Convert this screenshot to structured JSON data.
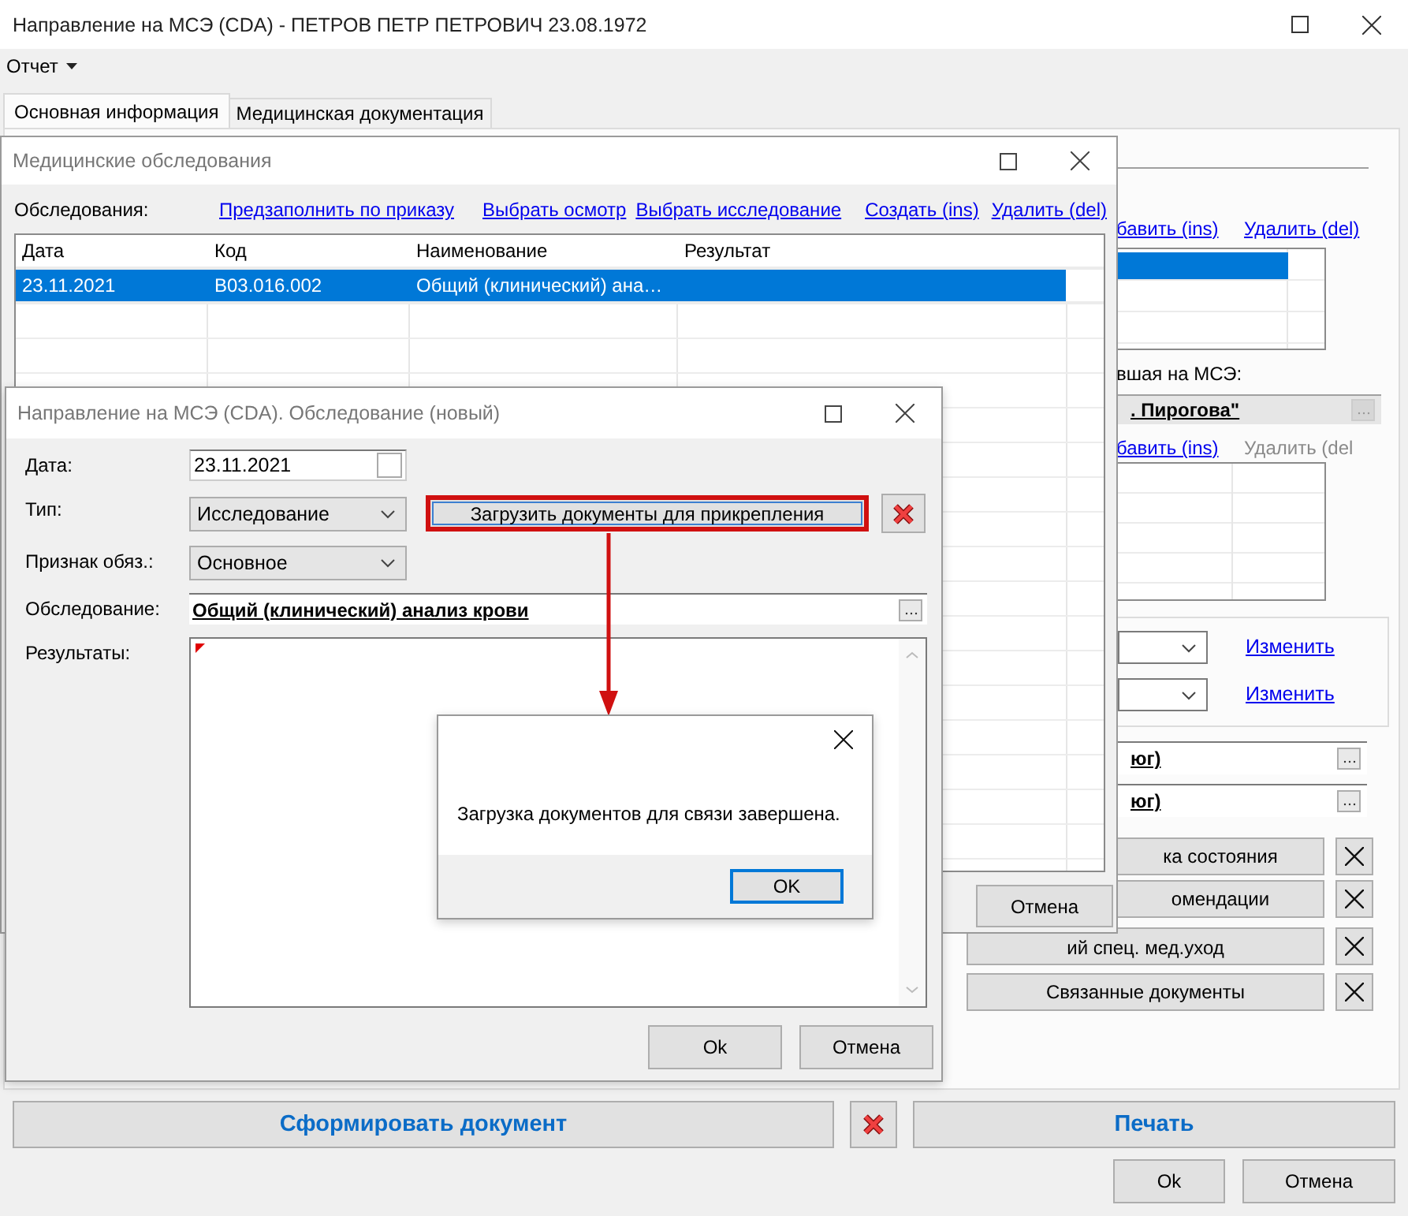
{
  "main_window": {
    "title": "Направление на МСЭ (CDA) - ПЕТРОВ ПЕТР ПЕТРОВИЧ 23.08.1972",
    "menu": [
      {
        "label": "Отчет"
      }
    ],
    "tabs": [
      {
        "label": "Основная информация",
        "selected": true
      },
      {
        "label": "Медицинская документация",
        "selected": false
      }
    ],
    "panel": {
      "links_1": [
        {
          "label": "бавить (ins)",
          "disabled": false
        },
        {
          "label": "Удалить (del)",
          "disabled": false
        }
      ],
      "grid_1": {
        "rows": [
          {
            "selected": true
          },
          {
            "selected": false
          },
          {
            "selected": false
          }
        ]
      },
      "organization_label": "вшая на МСЭ:",
      "organization_value": ". Пирогова\"",
      "links_2": [
        {
          "label": "бавить (ins)",
          "disabled": false
        },
        {
          "label": "Удалить (del",
          "disabled": true
        }
      ],
      "change_links": [
        {
          "label": "Изменить"
        },
        {
          "label": "Изменить"
        }
      ],
      "fields": [
        {
          "value": "юг)"
        },
        {
          "value": "юг)"
        }
      ],
      "document_buttons": [
        {
          "label": "ка состояния"
        },
        {
          "label": "омендации"
        },
        {
          "label": "ий спец. мед.уход"
        },
        {
          "label": "Связанные документы"
        }
      ]
    },
    "generate_button": "Сформировать документ",
    "print_button": "Печать",
    "buttons": [
      "Ok",
      "Отмена"
    ]
  },
  "exams_window": {
    "title": "Медицинские обследования",
    "label": "Обследования:",
    "links": [
      "Предзаполнить по приказу",
      "Выбрать осмотр",
      "Выбрать исследование",
      "Создать (ins)",
      "Удалить (del)"
    ],
    "columns": [
      "Дата",
      "Код",
      "Наименование",
      "Результат"
    ],
    "rows": [
      {
        "cells": [
          "23.11.2021",
          "B03.016.002",
          "Общий (клинический) ана…"
        ],
        "selected": true
      }
    ],
    "buttons": [
      "Отмена"
    ]
  },
  "exam_dialog": {
    "title": "Направление на МСЭ (CDA). Обследование (новый)",
    "fields": [
      {
        "label": "Дата:",
        "kind": "date",
        "value": "23.11.2021"
      },
      {
        "label": "Тип:",
        "kind": "select",
        "value": "Исследование",
        "action": {
          "label": "Загрузить документы для прикрепления",
          "highlighted": true
        }
      },
      {
        "label": "Признак обяз.:",
        "kind": "select",
        "value": "Основное"
      },
      {
        "label": "Обследование:",
        "kind": "lookup",
        "value": "Общий (клинический) анализ крови"
      },
      {
        "label": "Результаты:",
        "kind": "textarea"
      }
    ],
    "buttons": [
      "Ok",
      "Отмена"
    ]
  },
  "message_box": {
    "text": "Загрузка документов для связи завершена.",
    "button": "OK"
  }
}
